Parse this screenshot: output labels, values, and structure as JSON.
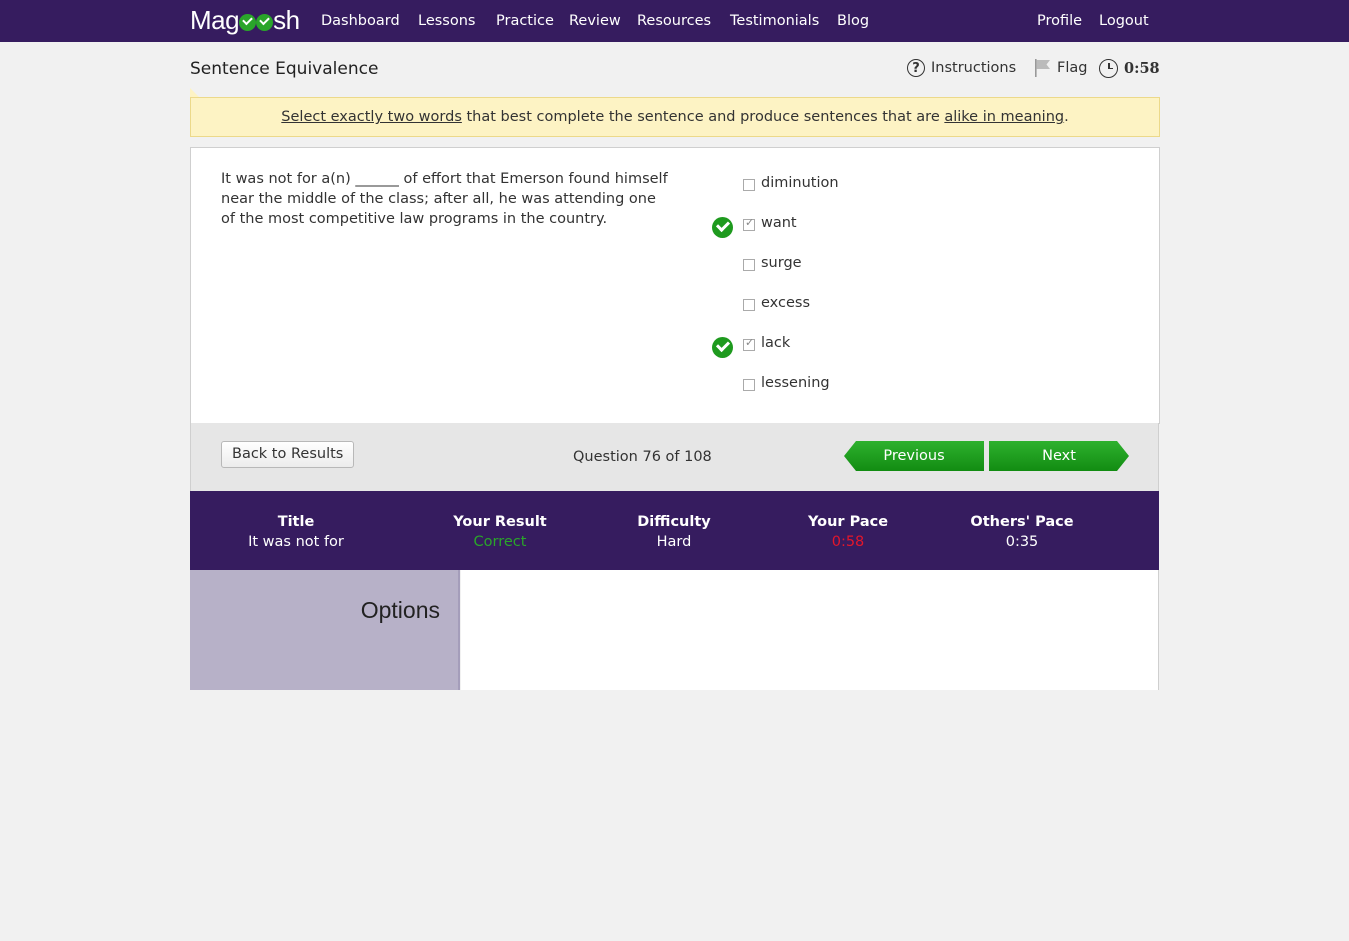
{
  "brand": {
    "name_part1": "Mag",
    "name_part2": "sh",
    "logo_check_colors": "#2aa52a"
  },
  "nav": {
    "items": [
      "Dashboard",
      "Lessons",
      "Practice",
      "Review",
      "Resources",
      "Testimonials",
      "Blog"
    ],
    "right": [
      "Profile",
      "Logout"
    ]
  },
  "header": {
    "section_title": "Sentence Equivalence",
    "instructions": "Instructions",
    "flag": "Flag",
    "timer": "0:58"
  },
  "banner": {
    "part1": "Select exactly two words",
    "part2": " that best complete the sentence and produce sentences that are ",
    "part3": "alike in meaning",
    "part4": "."
  },
  "question": {
    "stem": "It was not for a(n) ______ of effort that Emerson found himself near the middle of the class; after all, he was attending one of the most competitive law programs in the country.",
    "choices": [
      {
        "label": "diminution",
        "checked": false,
        "correct": false
      },
      {
        "label": "want",
        "checked": true,
        "correct": true
      },
      {
        "label": "surge",
        "checked": false,
        "correct": false
      },
      {
        "label": "excess",
        "checked": false,
        "correct": false
      },
      {
        "label": "lack",
        "checked": true,
        "correct": true
      },
      {
        "label": "lessening",
        "checked": false,
        "correct": false
      }
    ]
  },
  "footer": {
    "back_label": "Back to Results",
    "counter": "Question 76 of 108",
    "prev_label": "Previous",
    "next_label": "Next"
  },
  "stats": {
    "title_h": "Title",
    "title_v": "It was not for",
    "result_h": "Your Result",
    "result_v": "Correct",
    "difficulty_h": "Difficulty",
    "difficulty_v": "Hard",
    "pace_h": "Your Pace",
    "pace_v": "0:58",
    "others_h": "Others' Pace",
    "others_v": "0:35"
  },
  "options": {
    "title": "Options"
  },
  "colors": {
    "nav_bg": "#361c5f",
    "correct": "#2aa52a",
    "pace_over": "#e3162b",
    "banner_bg": "#fdf3c4"
  }
}
